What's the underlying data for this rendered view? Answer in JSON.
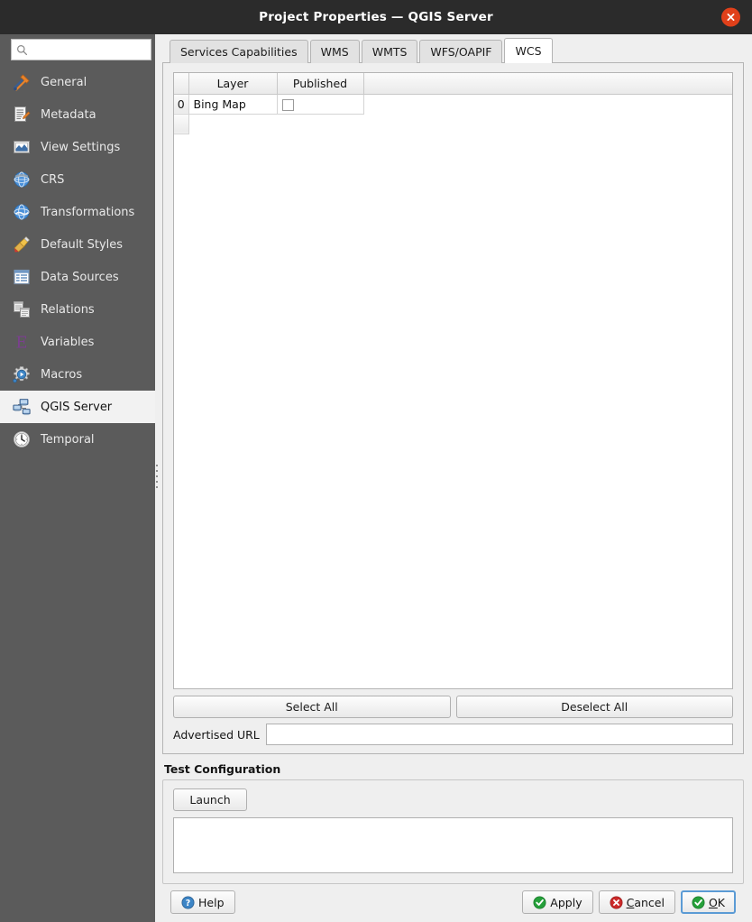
{
  "window": {
    "title": "Project Properties — QGIS Server",
    "close_label": "Close",
    "close_icon": "close-icon"
  },
  "sidebar": {
    "search": {
      "value": "",
      "placeholder": "",
      "icon": "search-icon"
    },
    "items": [
      {
        "label": "General",
        "icon": "hammer-wrench-icon"
      },
      {
        "label": "Metadata",
        "icon": "document-pencil-icon"
      },
      {
        "label": "View Settings",
        "icon": "map-view-icon"
      },
      {
        "label": "CRS",
        "icon": "globe-crs-icon"
      },
      {
        "label": "Transformations",
        "icon": "globe-transform-icon"
      },
      {
        "label": "Default Styles",
        "icon": "paintbrush-icon"
      },
      {
        "label": "Data Sources",
        "icon": "table-grid-icon"
      },
      {
        "label": "Relations",
        "icon": "relations-tables-icon"
      },
      {
        "label": "Variables",
        "icon": "epsilon-variable-icon"
      },
      {
        "label": "Macros",
        "icon": "gear-play-icon"
      },
      {
        "label": "QGIS Server",
        "icon": "server-network-icon"
      },
      {
        "label": "Temporal",
        "icon": "clock-icon"
      }
    ],
    "selected_index": 10
  },
  "main": {
    "tabs": [
      {
        "label": "Services Capabilities",
        "active": false
      },
      {
        "label": "WMS",
        "active": false
      },
      {
        "label": "WMTS",
        "active": false
      },
      {
        "label": "WFS/OAPIF",
        "active": false
      },
      {
        "label": "WCS",
        "active": true
      }
    ],
    "table": {
      "headers": {
        "corner": "",
        "layer": "Layer",
        "published": "Published"
      },
      "rows": [
        {
          "index": "0",
          "layer": "Bing Map",
          "published": false
        }
      ]
    },
    "select_all_label": "Select All",
    "deselect_all_label": "Deselect All",
    "advertised_url": {
      "label": "Advertised URL",
      "value": "",
      "placeholder": ""
    },
    "test_configuration": {
      "title": "Test Configuration",
      "launch_label": "Launch",
      "log_value": ""
    }
  },
  "dialog_buttons": {
    "help": {
      "label": "Help",
      "icon": "help-icon",
      "underline": ""
    },
    "apply": {
      "label": "Apply",
      "icon": "check-icon",
      "underline": ""
    },
    "cancel": {
      "label": "ancel",
      "icon": "cancel-icon",
      "underline": "C"
    },
    "ok": {
      "label": "K",
      "icon": "check-icon",
      "underline": "O",
      "focused": true
    }
  },
  "colors": {
    "titlebar_bg": "#2b2b2b",
    "sidebar_bg": "#5b5b5b",
    "panel_bg": "#efefef",
    "close_btn": "#e0401a",
    "accent_green": "#25a03a",
    "accent_red": "#cc2a2a",
    "accent_blue": "#3d85c6",
    "focus_blue": "#5b9bd5"
  }
}
